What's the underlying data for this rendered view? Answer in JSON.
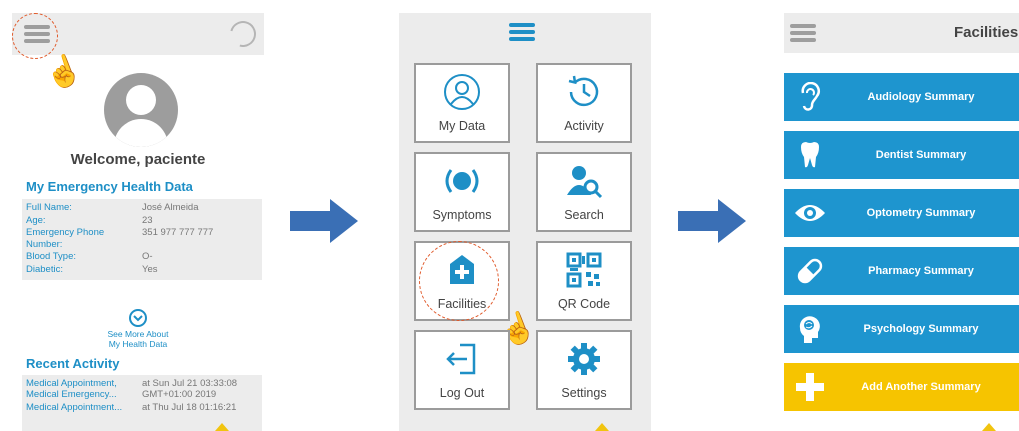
{
  "screen1": {
    "welcome": "Welcome, paciente",
    "emergency_title": "My Emergency Health Data",
    "fields": [
      {
        "key": "Full Name:",
        "value": "José Almeida"
      },
      {
        "key": "Age:",
        "value": "23"
      },
      {
        "key": "Emergency Phone Number:",
        "value": "351 977 777 777"
      },
      {
        "key": "Blood Type:",
        "value": "O-"
      },
      {
        "key": "Diabetic:",
        "value": "Yes"
      }
    ],
    "see_more_line1": "See More About",
    "see_more_line2": "My Health Data",
    "recent_title": "Recent Activity",
    "activity": [
      {
        "key": "Medical Appointment, Medical Emergency...",
        "value": "at Sun Jul 21 03:33:08 GMT+01:00 2019"
      },
      {
        "key": "Medical Appointment...",
        "value": "at Thu Jul 18 01:16:21"
      }
    ]
  },
  "screen2": {
    "tiles": [
      {
        "label": "My Data",
        "icon": "person-circle-icon"
      },
      {
        "label": "Activity",
        "icon": "clock-history-icon"
      },
      {
        "label": "Symptoms",
        "icon": "signal-icon"
      },
      {
        "label": "Search",
        "icon": "user-search-icon"
      },
      {
        "label": "Facilities",
        "icon": "house-plus-icon"
      },
      {
        "label": "QR Code",
        "icon": "qr-code-icon"
      },
      {
        "label": "Log Out",
        "icon": "logout-icon"
      },
      {
        "label": "Settings",
        "icon": "gear-icon"
      }
    ]
  },
  "screen3": {
    "title": "Facilities",
    "buttons": [
      {
        "label": "Audiology Summary",
        "icon": "ear-icon"
      },
      {
        "label": "Dentist Summary",
        "icon": "tooth-icon"
      },
      {
        "label": "Optometry Summary",
        "icon": "eye-icon"
      },
      {
        "label": "Pharmacy Summary",
        "icon": "pill-icon"
      },
      {
        "label": "Psychology Summary",
        "icon": "brain-icon"
      },
      {
        "label": "Add Another Summary",
        "icon": "plus-icon"
      }
    ]
  },
  "colors": {
    "accent": "#1e8fc6",
    "button_blue": "#1e95cf",
    "add_yellow": "#f6c400",
    "highlight_orange": "#e05a2b",
    "flow_arrow": "#3a6fb5"
  }
}
